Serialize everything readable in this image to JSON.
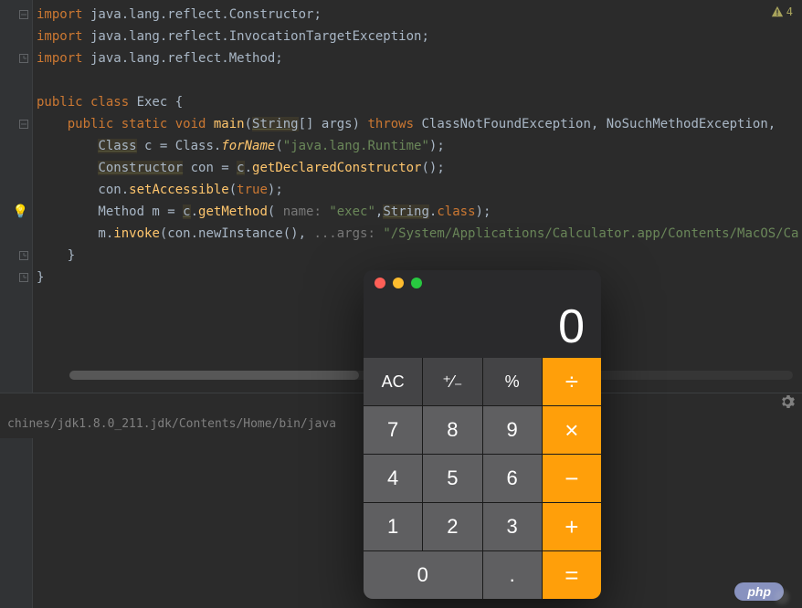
{
  "warnings": {
    "icon": "⚠",
    "count": "4"
  },
  "gutter": {
    "bulb": "💡"
  },
  "code": {
    "l1": {
      "imp": "import",
      "pkg": " java.lang.reflect.Constructor;"
    },
    "l2": {
      "imp": "import",
      "pkg": " java.lang.reflect.InvocationTargetException;"
    },
    "l3": {
      "imp": "import",
      "pkg": " java.lang.reflect.Method;"
    },
    "l5": {
      "pub": "public class ",
      "name": "Exec",
      "open": " {"
    },
    "l6": {
      "pub": "    public static void ",
      "main": "main",
      "lp": "(",
      "type": "String",
      "arr": "[] args) ",
      "throws": "throws ",
      "ex": "ClassNotFoundException, NoSuchMethodException,"
    },
    "l7": {
      "pad": "        ",
      "type": "Class",
      "rest": " c = Class.",
      "forname": "forName",
      "lp": "(",
      "str": "\"java.lang.Runtime\"",
      "rp": ");"
    },
    "l8": {
      "pad": "        ",
      "type": "Constructor",
      "rest": " con = ",
      "obj": "c",
      "dot": ".",
      "method": "getDeclaredConstructor",
      "rp": "();"
    },
    "l9": {
      "pad": "        con.",
      "method": "setAccessible",
      "lp": "(",
      "true": "true",
      "rp": ");"
    },
    "l10": {
      "pad": "        Method m = ",
      "obj": "c",
      "dot": ".",
      "method": "getMethod",
      "lp": "( ",
      "hint": "name: ",
      "str": "\"exec\"",
      "comma": ",",
      "type": "String",
      "dotclass": ".",
      "class": "class",
      "rp": ");"
    },
    "l11": {
      "pad": "        m.",
      "method": "invoke",
      "lp": "(con.newInstance(), ",
      "hint": "...args: ",
      "str": "\"/System/Applications/Calculator.app/Contents/MacOS/Ca"
    },
    "l12": {
      "pad": "    }"
    },
    "l13": {
      "pad": "}"
    }
  },
  "run": {
    "path": "chines/jdk1.8.0_211.jdk/Contents/Home/bin/java"
  },
  "calculator": {
    "display": "0",
    "buttons": {
      "ac": "AC",
      "sign": "⁺⁄₋",
      "percent": "%",
      "divide": "÷",
      "7": "7",
      "8": "8",
      "9": "9",
      "multiply": "×",
      "4": "4",
      "5": "5",
      "6": "6",
      "minus": "−",
      "1": "1",
      "2": "2",
      "3": "3",
      "plus": "+",
      "0": "0",
      "dot": ".",
      "equals": "="
    }
  },
  "badge": {
    "php": "php"
  }
}
